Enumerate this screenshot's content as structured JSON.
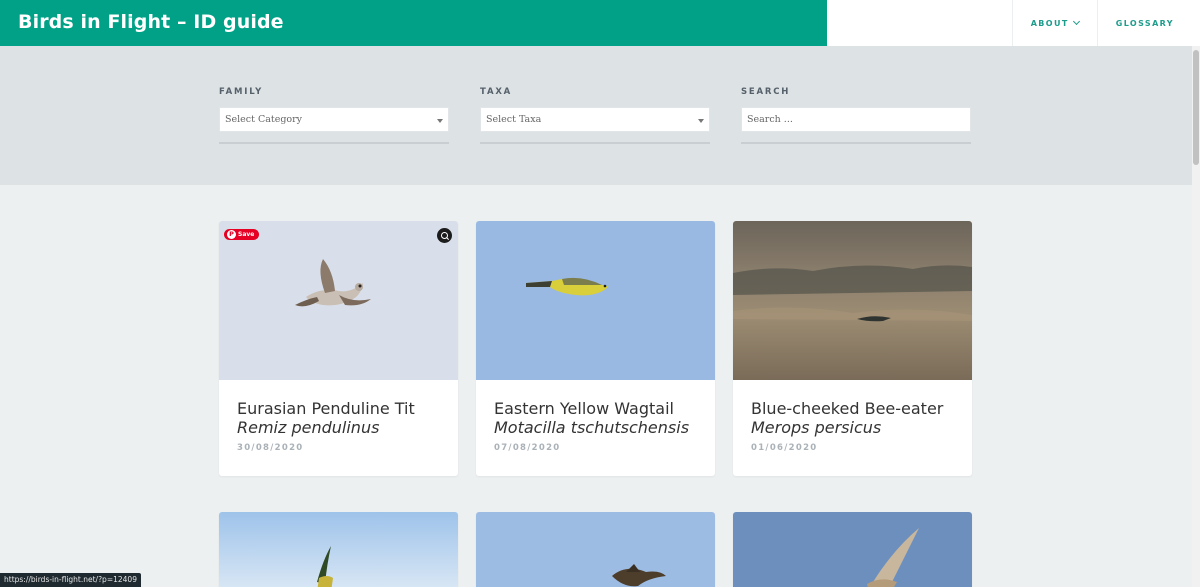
{
  "header": {
    "site_title": "Birds in Flight – ID guide",
    "nav": [
      {
        "label": "About",
        "has_dropdown": true
      },
      {
        "label": "Glossary",
        "has_dropdown": false
      }
    ],
    "brand_color": "#00a187"
  },
  "filters": {
    "family": {
      "label": "Family",
      "value": "Select Category"
    },
    "taxa": {
      "label": "Taxa",
      "value": "Select Taxa"
    },
    "search": {
      "label": "Search",
      "placeholder": "Search ..."
    }
  },
  "cards": [
    {
      "title": "Eurasian Penduline Tit",
      "scientific": "Remiz pendulinus",
      "date": "30/08/2020",
      "save_label": "Save"
    },
    {
      "title": "Eastern Yellow Wagtail",
      "scientific": "Motacilla tschutschensis",
      "date": "07/08/2020"
    },
    {
      "title": "Blue-cheeked Bee-eater",
      "scientific": "Merops persicus",
      "date": "01/06/2020"
    }
  ],
  "status_url": "https://birds-in-flight.net/?p=12409",
  "icons": {
    "pinterest": "pinterest-icon",
    "lens": "visual-search-icon",
    "caret": "caret-down-icon"
  }
}
